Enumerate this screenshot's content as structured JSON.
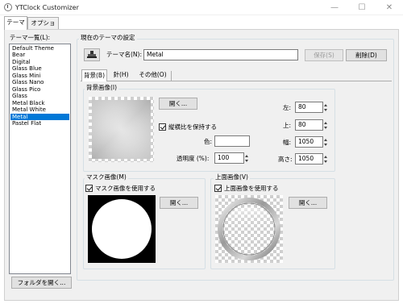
{
  "window": {
    "title": "YTClock Customizer",
    "minimize_glyph": "—",
    "maximize_glyph": "☐",
    "close_glyph": "✕"
  },
  "tabs": [
    {
      "label": "テーマ",
      "active": true
    },
    {
      "label": "オプション",
      "active": false
    }
  ],
  "theme_list": {
    "label": "テーマ一覧(L):",
    "items": [
      "Default Theme",
      "Bear",
      "Digital",
      "Glass Blue",
      "Glass Mini",
      "Glass Nano",
      "Glass Pico",
      "Glass",
      "Metal Black",
      "Metal White",
      "Metal",
      "Pastel Flat"
    ],
    "selected": "Metal",
    "open_folder_label": "フォルダを開く..."
  },
  "current_settings": {
    "group_label": "現在のテーマの設定",
    "theme_name_label": "テーマ名(N):",
    "theme_name_value": "Metal",
    "save_label": "保存(S)",
    "delete_label": "削除(D)",
    "icon": "stamp-icon"
  },
  "sub_tabs": [
    {
      "label": "背景(B)",
      "active": true
    },
    {
      "label": "針(H)",
      "active": false
    },
    {
      "label": "その他(O)",
      "active": false
    }
  ],
  "background": {
    "group_label": "背景画像(I)",
    "open_label": "開く...",
    "keep_aspect_label": "縦横比を保持する",
    "keep_aspect_checked": true,
    "color_label": "色:",
    "color_value": "",
    "opacity_label": "透明度 (%):",
    "opacity_value": "100",
    "left_label": "左:",
    "left_value": "80",
    "top_label": "上:",
    "top_value": "80",
    "width_label": "幅:",
    "width_value": "1050",
    "height_label": "高さ:",
    "height_value": "1050"
  },
  "mask": {
    "group_label": "マスク画像(M)",
    "use_label": "マスク画像を使用する",
    "use_checked": true,
    "open_label": "開く..."
  },
  "overlay": {
    "group_label": "上面画像(V)",
    "use_label": "上面画像を使用する",
    "use_checked": true,
    "open_label": "開く..."
  },
  "colors": {
    "selection": "#0078d7",
    "panel": "#f0f0f0"
  }
}
